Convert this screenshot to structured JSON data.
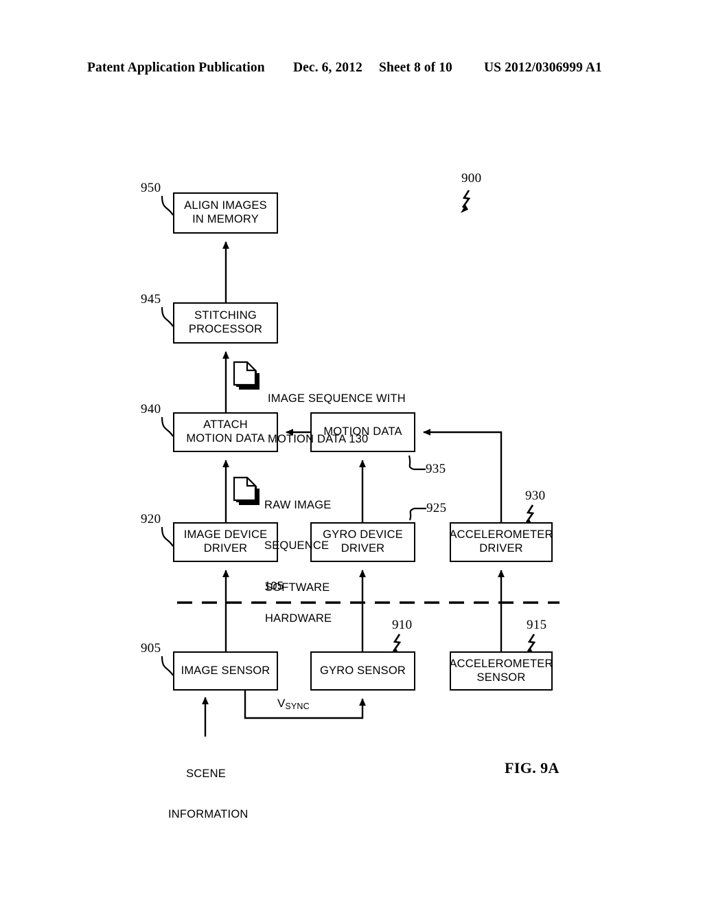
{
  "header": {
    "publication": "Patent Application Publication",
    "date": "Dec. 6, 2012",
    "sheet": "Sheet 8 of 10",
    "number": "US 2012/0306999 A1"
  },
  "figure": {
    "caption": "FIG. 9A",
    "diagram_ref": "900",
    "boundary": {
      "software_label": "SOFTWARE",
      "hardware_label": "HARDWARE"
    },
    "nodes": [
      {
        "id": "align",
        "ref": "950",
        "line1": "ALIGN IMAGES",
        "line2": "IN MEMORY"
      },
      {
        "id": "stitching",
        "ref": "945",
        "line1": "STITCHING",
        "line2": "PROCESSOR"
      },
      {
        "id": "attach",
        "ref": "940",
        "line1": "ATTACH",
        "line2": "MOTION DATA"
      },
      {
        "id": "motiondata",
        "ref": "935",
        "line1": "MOTION DATA",
        "line2": ""
      },
      {
        "id": "imagedriver",
        "ref": "920",
        "line1": "IMAGE DEVICE",
        "line2": "DRIVER"
      },
      {
        "id": "gyrodriver",
        "ref": "925",
        "line1": "GYRO DEVICE",
        "line2": "DRIVER"
      },
      {
        "id": "acceldriver",
        "ref": "930",
        "line1": "ACCELEROMETER",
        "line2": "DRIVER"
      },
      {
        "id": "imagesensor",
        "ref": "905",
        "line1": "IMAGE SENSOR",
        "line2": ""
      },
      {
        "id": "gyrosensor",
        "ref": "910",
        "line1": "GYRO SENSOR",
        "line2": ""
      },
      {
        "id": "accelsensor",
        "ref": "915",
        "line1": "ACCELEROMETER",
        "line2": "SENSOR"
      }
    ],
    "annotations": {
      "image_sequence_with_motion": {
        "line1": "IMAGE SEQUENCE WITH",
        "line2": "MOTION DATA 130"
      },
      "raw_image_sequence": {
        "line1": "RAW IMAGE",
        "line2": "SEQUENCE",
        "line3": "105"
      },
      "scene_information": {
        "line1": "SCENE",
        "line2": "INFORMATION"
      },
      "vsync": {
        "base": "V",
        "subscript": "SYNC"
      }
    },
    "colors": {
      "ink": "#000000",
      "paper": "#ffffff"
    }
  }
}
